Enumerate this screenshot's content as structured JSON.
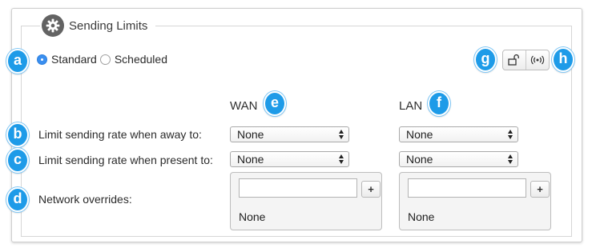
{
  "section": {
    "title": "Sending Limits",
    "icon": "gear-icon"
  },
  "callouts": {
    "a": "a",
    "b": "b",
    "c": "c",
    "d": "d",
    "e": "e",
    "f": "f",
    "g": "g",
    "h": "h"
  },
  "schedule_mode": {
    "options": [
      {
        "label": "Standard",
        "selected": true
      },
      {
        "label": "Scheduled",
        "selected": false
      }
    ]
  },
  "toolbar": {
    "buttons": [
      "unlock-icon",
      "wireless-icon"
    ]
  },
  "columns": {
    "wan": "WAN",
    "lan": "LAN"
  },
  "rows": {
    "away": {
      "label": "Limit sending rate when away to:",
      "wan_value": "None",
      "lan_value": "None"
    },
    "present": {
      "label": "Limit sending rate when present to:",
      "wan_value": "None",
      "lan_value": "None"
    },
    "overrides": {
      "label": "Network overrides:",
      "wan_value": "None",
      "lan_value": "None",
      "wan_input": "",
      "lan_input": "",
      "add_label": "+"
    }
  },
  "colors": {
    "accent": "#1e9be8",
    "radio_selected": "#3a8ff0",
    "gear": "#636363"
  }
}
